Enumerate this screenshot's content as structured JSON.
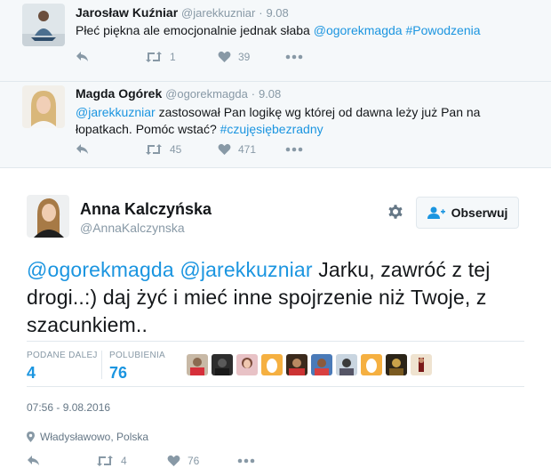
{
  "replies": [
    {
      "name": "Jarosław Kuźniar",
      "handle": "@jarekkuzniar",
      "separator": "·",
      "time": "9.08",
      "text_plain": "Płeć piękna ale emocjonalnie jednak słaba ",
      "text_link1": "@ogorekmagda",
      "text_link2": "#Powodzenia",
      "retweets": "1",
      "likes": "39"
    },
    {
      "name": "Magda Ogórek",
      "handle": "@ogorekmagda",
      "separator": "·",
      "time": "9.08",
      "text_link1": "@jarekkuzniar",
      "text_plain": " zastosował Pan logikę wg której od dawna leży już Pan na łopatkach. Pomóc wstać? ",
      "text_link2": "#czujęsiębezradny",
      "retweets": "45",
      "likes": "471"
    }
  ],
  "main": {
    "name": "Anna Kalczyńska",
    "handle": "@AnnaKalczynska",
    "follow_label": "Obserwuj",
    "mention1": "@ogorekmagda",
    "mention2": "@jarekkuzniar",
    "text": " Jarku, zawróć z tej drogi..:) daj żyć i mieć inne spojrzenie niż Twoje, z szacunkiem..",
    "retweets_label": "PODANE DALEJ",
    "retweets_value": "4",
    "likes_label": "POLUBIENIA",
    "likes_value": "76",
    "datetime": "07:56 - 9.08.2016",
    "location": "Władysławowo, Polska",
    "action_retweets": "4",
    "action_likes": "76"
  },
  "icons": {
    "reply": "reply-icon",
    "retweet": "retweet-icon",
    "like": "heart-icon",
    "more": "more-icon",
    "gear": "gear-icon",
    "follow": "add-user-icon",
    "location": "location-pin-icon"
  },
  "colors": {
    "link": "#1b95e0",
    "muted": "#8899a6",
    "reply_bg": "#f5f8fa"
  }
}
